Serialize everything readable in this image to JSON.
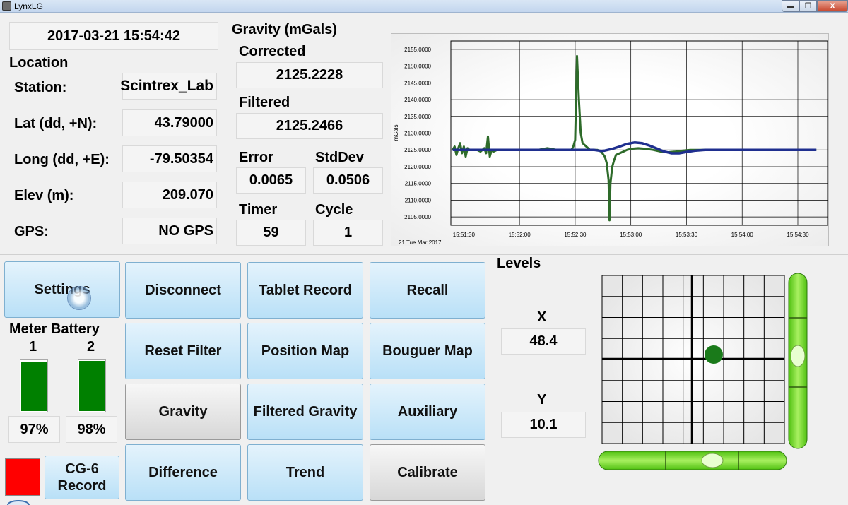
{
  "window": {
    "title": "LynxLG",
    "min": "▬",
    "max": "❐",
    "close": "X"
  },
  "datetime": "2017-03-21  15:54:42",
  "location": {
    "heading": "Location",
    "station_label": "Station:",
    "station": "Scintrex_Lab",
    "lat_label": "Lat (dd, +N):",
    "lat": "43.79000",
    "long_label": "Long (dd, +E):",
    "long": "-79.50354",
    "elev_label": "Elev (m):",
    "elev": "209.070",
    "gps_label": "GPS:",
    "gps": "NO GPS"
  },
  "gravity": {
    "heading": "Gravity (mGals)",
    "corrected_label": "Corrected",
    "corrected": "2125.2228",
    "filtered_label": "Filtered",
    "filtered": "2125.2466",
    "error_label": "Error",
    "error": "0.0065",
    "stddev_label": "StdDev",
    "stddev": "0.0506",
    "timer_label": "Timer",
    "timer": "59",
    "cycle_label": "Cycle",
    "cycle": "1"
  },
  "chart_data": {
    "type": "line",
    "ylabel": "mGals",
    "date_label": "21 Tue Mar 2017",
    "ylim": [
      2102.5,
      2157.5
    ],
    "yticks": [
      2105,
      2110,
      2115,
      2120,
      2125,
      2130,
      2135,
      2140,
      2145,
      2150,
      2155
    ],
    "ytick_labels": [
      "2105.0000",
      "2110.0000",
      "2115.0000",
      "2120.0000",
      "2125.0000",
      "2130.0000",
      "2135.0000",
      "2140.0000",
      "2145.0000",
      "2150.0000",
      "2155.0000"
    ],
    "xticks": [
      "15:51:30",
      "15:52:00",
      "15:52:30",
      "15:53:00",
      "15:53:30",
      "15:54:00",
      "15:54:30"
    ],
    "xtick_seconds": [
      30,
      60,
      90,
      120,
      150,
      180,
      210
    ],
    "xlim_seconds": [
      23,
      226
    ],
    "series": [
      {
        "color": "#2e6b2a",
        "x": [
          24,
          25,
          26,
          27,
          28,
          29,
          30,
          31,
          32,
          33,
          34,
          35,
          37,
          39,
          41,
          42,
          43,
          44,
          45,
          46,
          48,
          50,
          55,
          60,
          65,
          70,
          75,
          80,
          83,
          86,
          87,
          88,
          89,
          90,
          91,
          92,
          93,
          94,
          96,
          98,
          100,
          102,
          104,
          106,
          107,
          108,
          108.5,
          109,
          110,
          111,
          112,
          114,
          116,
          118,
          120,
          124,
          128,
          132,
          136,
          140,
          144,
          148,
          152,
          156,
          160,
          170,
          180,
          190,
          200,
          210,
          220
        ],
        "y": [
          2125,
          2126,
          2123.5,
          2125.5,
          2127,
          2124,
          2126,
          2123,
          2125.5,
          2125,
          2125,
          2125,
          2125,
          2124.5,
          2125.5,
          2124,
          2129,
          2123,
          2125,
          2124.5,
          2125,
          2125,
          2125,
          2125,
          2125,
          2125,
          2125.5,
          2125,
          2125,
          2125,
          2125,
          2125,
          2126,
          2128,
          2153,
          2140,
          2130,
          2127,
          2126,
          2125,
          2125,
          2125,
          2124.5,
          2123,
          2121,
          2116,
          2104,
          2115,
          2120,
          2122,
          2123.5,
          2124,
          2124.5,
          2125,
          2125.3,
          2125.5,
          2125.3,
          2125,
          2124.5,
          2124.3,
          2124.5,
          2124.8,
          2125,
          2125,
          2125,
          2125,
          2125,
          2125,
          2125,
          2125,
          2125
        ]
      },
      {
        "color": "#1f2f8f",
        "x": [
          24,
          40,
          60,
          80,
          90,
          95,
          100,
          104,
          106,
          110,
          114,
          118,
          122,
          126,
          130,
          134,
          138,
          142,
          146,
          150,
          155,
          160,
          170,
          180,
          190,
          200,
          210,
          220
        ],
        "y": [
          2125,
          2125,
          2125,
          2125,
          2125,
          2125,
          2125,
          2124.7,
          2124.8,
          2125.3,
          2126,
          2126.8,
          2127.2,
          2127,
          2126.3,
          2125.4,
          2124.5,
          2124,
          2124,
          2124.4,
          2124.8,
          2125,
          2125,
          2125,
          2125,
          2125,
          2125,
          2125
        ]
      }
    ]
  },
  "buttons": {
    "settings": "Settings",
    "disconnect": "Disconnect",
    "tablet_record": "Tablet Record",
    "recall": "Recall",
    "reset_filter": "Reset Filter",
    "position_map": "Position Map",
    "bouguer_map": "Bouguer Map",
    "gravity": "Gravity",
    "filtered_gravity": "Filtered Gravity",
    "auxiliary": "Auxiliary",
    "difference": "Difference",
    "trend": "Trend",
    "calibrate": "Calibrate",
    "cg6_record_line1": "CG-6",
    "cg6_record_line2": "Record"
  },
  "battery": {
    "heading": "Meter Battery",
    "b1_label": "1",
    "b1_value": "97%",
    "b1_level": 0.97,
    "b2_label": "2",
    "b2_value": "98%",
    "b2_level": 0.98,
    "bar_color": "#008000"
  },
  "status_indicator_color": "#ff0000",
  "levels": {
    "heading": "Levels",
    "x_label": "X",
    "x_value": "48.4",
    "y_label": "Y",
    "y_value": "10.1",
    "dot_color": "#1a7a1a",
    "bubble_color": "#66e01a"
  }
}
